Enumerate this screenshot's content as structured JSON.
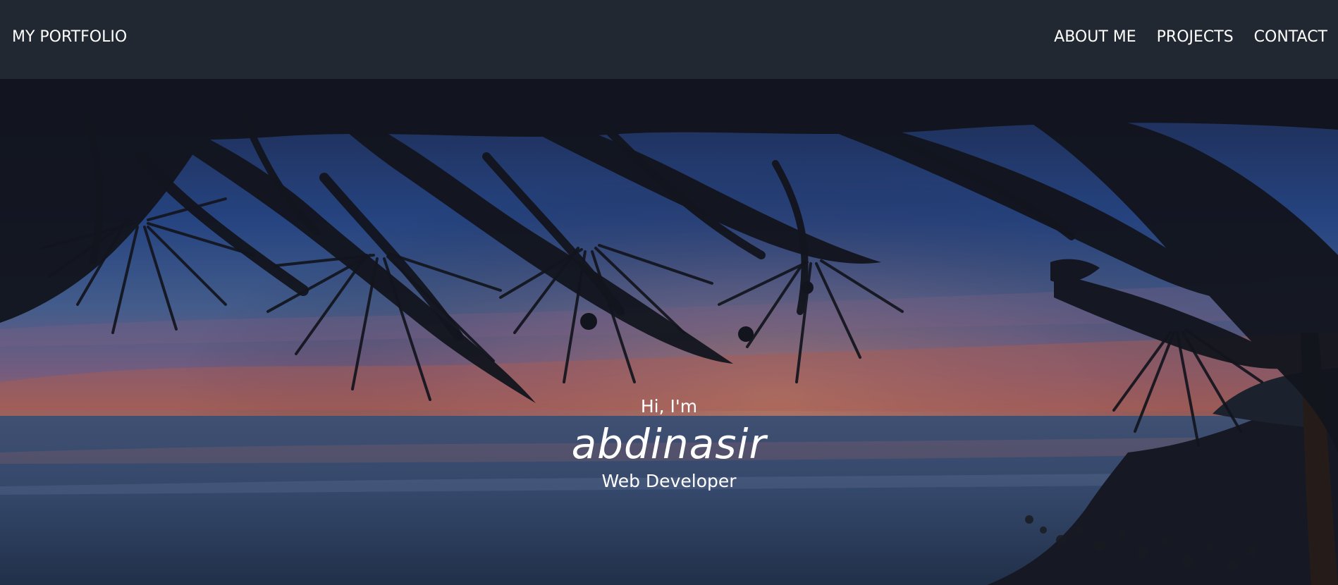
{
  "navbar": {
    "brand": "MY PORTFOLIO",
    "links": [
      {
        "label": "ABOUT ME"
      },
      {
        "label": "PROJECTS"
      },
      {
        "label": "CONTACT"
      }
    ]
  },
  "hero": {
    "greeting": "Hi, I'm",
    "name": "abdinasir",
    "role": "Web Developer"
  },
  "colors": {
    "navbar_bg": "#222831",
    "text": "#ffffff"
  }
}
